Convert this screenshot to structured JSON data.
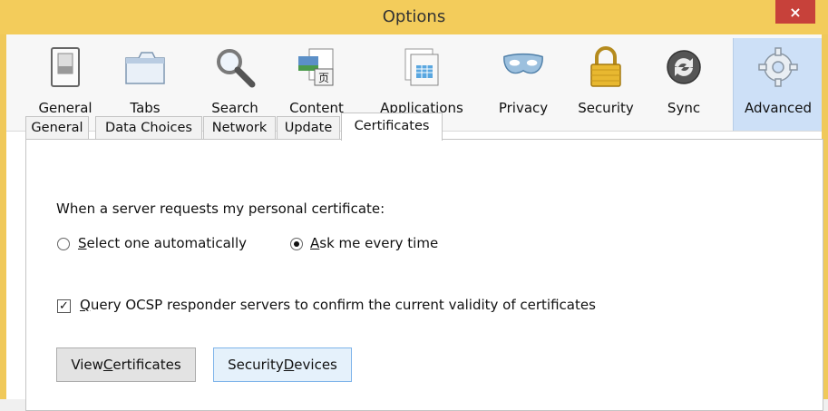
{
  "window": {
    "title": "Options",
    "close_glyph": "×"
  },
  "toolbar": {
    "items": [
      {
        "label": "General",
        "icon": "general-switch-icon"
      },
      {
        "label": "Tabs",
        "icon": "tabs-icon"
      },
      {
        "label": "Search",
        "icon": "search-icon"
      },
      {
        "label": "Content",
        "icon": "content-icon"
      },
      {
        "label": "Applications",
        "icon": "applications-icon"
      },
      {
        "label": "Privacy",
        "icon": "privacy-mask-icon"
      },
      {
        "label": "Security",
        "icon": "security-lock-icon"
      },
      {
        "label": "Sync",
        "icon": "sync-icon"
      },
      {
        "label": "Advanced",
        "icon": "advanced-gear-icon",
        "selected": true
      }
    ]
  },
  "subtabs": {
    "items": [
      "General",
      "Data Choices",
      "Network",
      "Update",
      "Certificates"
    ],
    "active": "Certificates"
  },
  "certificates": {
    "prompt": "When a server requests my personal certificate:",
    "radio_auto_mnemonic": "S",
    "radio_auto_rest": "elect one automatically",
    "radio_ask_mnemonic": "A",
    "radio_ask_rest": "sk me every time",
    "selected_radio": "Ask me every time",
    "ocsp_mnemonic": "Q",
    "ocsp_rest": "uery OCSP responder servers to confirm the current validity of certificates",
    "ocsp_checked": true,
    "view_btn_pre": "View ",
    "view_btn_mnemonic": "C",
    "view_btn_post": "ertificates",
    "devices_btn_pre": "Security ",
    "devices_btn_mnemonic": "D",
    "devices_btn_post": "evices"
  },
  "colors": {
    "titlebar": "#f3cc5b",
    "close": "#c7413a",
    "selected_tool": "#cde0f7"
  }
}
